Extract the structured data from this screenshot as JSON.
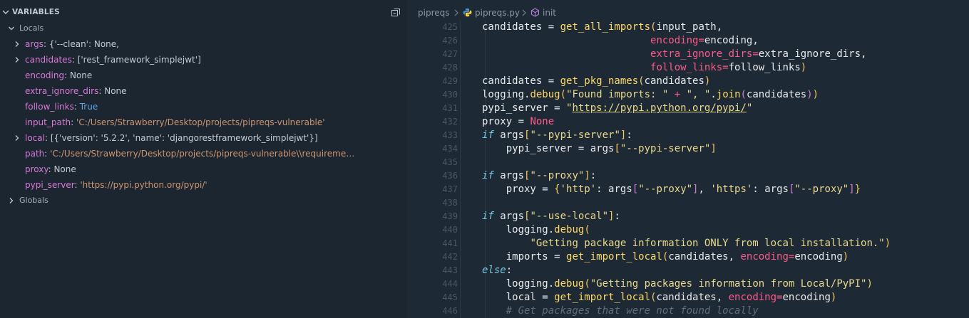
{
  "variables_panel": {
    "title": "VARIABLES",
    "locals_label": "Locals",
    "globals_label": "Globals",
    "locals": [
      {
        "name": "args",
        "value": "{'--clean': None,",
        "kind": "plain",
        "expandable": true
      },
      {
        "name": "candidates",
        "value": "['rest_framework_simplejwt']",
        "kind": "plain",
        "expandable": true
      },
      {
        "name": "encoding",
        "value": "None",
        "kind": "plain",
        "expandable": false
      },
      {
        "name": "extra_ignore_dirs",
        "value": "None",
        "kind": "plain",
        "expandable": false
      },
      {
        "name": "follow_links",
        "value": "True",
        "kind": "bool",
        "expandable": false
      },
      {
        "name": "input_path",
        "value": "'C:/Users/Strawberry/Desktop/projects/pipreqs-vulnerable'",
        "kind": "string",
        "expandable": false
      },
      {
        "name": "local",
        "value": "[{'version': '5.2.2', 'name': 'djangorestframework_simplejwt'}]",
        "kind": "plain",
        "expandable": true
      },
      {
        "name": "path",
        "value": "'C:/Users/Strawberry/Desktop/projects/pipreqs-vulnerable\\\\requireme…",
        "kind": "string",
        "expandable": false
      },
      {
        "name": "proxy",
        "value": "None",
        "kind": "plain",
        "expandable": false
      },
      {
        "name": "pypi_server",
        "value": "'https://pypi.python.org/pypi/'",
        "kind": "string",
        "expandable": false
      }
    ]
  },
  "breadcrumbs": [
    "pipreqs",
    "pipreqs.py",
    "init"
  ],
  "editor": {
    "lines": [
      {
        "n": "425",
        "indent": 0,
        "tokens": [
          [
            "var",
            "candidates "
          ],
          [
            "punc",
            "= "
          ],
          [
            "fn",
            "get_all_imports"
          ],
          [
            "paren",
            "("
          ],
          [
            "var",
            "input_path,"
          ]
        ]
      },
      {
        "n": "426",
        "indent": 0,
        "tokens": [
          [
            "var",
            "                            "
          ],
          [
            "param",
            "encoding"
          ],
          [
            "op",
            "="
          ],
          [
            "var",
            "encoding,"
          ]
        ]
      },
      {
        "n": "427",
        "indent": 0,
        "tokens": [
          [
            "var",
            "                            "
          ],
          [
            "param",
            "extra_ignore_dirs"
          ],
          [
            "op",
            "="
          ],
          [
            "var",
            "extra_ignore_dirs,"
          ]
        ]
      },
      {
        "n": "428",
        "indent": 0,
        "tokens": [
          [
            "var",
            "                            "
          ],
          [
            "param",
            "follow_links"
          ],
          [
            "op",
            "="
          ],
          [
            "var",
            "follow_links"
          ],
          [
            "paren",
            ")"
          ]
        ]
      },
      {
        "n": "429",
        "indent": 0,
        "tokens": [
          [
            "var",
            "candidates "
          ],
          [
            "punc",
            "= "
          ],
          [
            "fn",
            "get_pkg_names"
          ],
          [
            "paren",
            "("
          ],
          [
            "var",
            "candidates"
          ],
          [
            "paren",
            ")"
          ]
        ]
      },
      {
        "n": "430",
        "indent": 0,
        "tokens": [
          [
            "var",
            "logging."
          ],
          [
            "fn",
            "debug"
          ],
          [
            "paren",
            "("
          ],
          [
            "str",
            "\"Found imports: \""
          ],
          [
            "op",
            " + "
          ],
          [
            "str",
            "\", \""
          ],
          [
            "var",
            "."
          ],
          [
            "fn",
            "join"
          ],
          [
            "bracket",
            "("
          ],
          [
            "var",
            "candidates"
          ],
          [
            "bracket",
            ")"
          ],
          [
            "paren",
            ")"
          ]
        ]
      },
      {
        "n": "431",
        "indent": 0,
        "tokens": [
          [
            "var",
            "pypi_server "
          ],
          [
            "punc",
            "= "
          ],
          [
            "str",
            "\""
          ],
          [
            "url",
            "https://pypi.python.org/pypi/"
          ],
          [
            "str",
            "\""
          ]
        ]
      },
      {
        "n": "432",
        "indent": 0,
        "tokens": [
          [
            "var",
            "proxy "
          ],
          [
            "punc",
            "= "
          ],
          [
            "none",
            "None"
          ]
        ]
      },
      {
        "n": "433",
        "indent": 0,
        "tokens": [
          [
            "kw",
            "if "
          ],
          [
            "var",
            "args"
          ],
          [
            "paren",
            "["
          ],
          [
            "str",
            "\"--pypi-server\""
          ],
          [
            "paren",
            "]"
          ],
          [
            "var",
            ":"
          ]
        ]
      },
      {
        "n": "434",
        "indent": 1,
        "tokens": [
          [
            "var",
            "    pypi_server "
          ],
          [
            "punc",
            "= "
          ],
          [
            "var",
            "args"
          ],
          [
            "paren",
            "["
          ],
          [
            "str",
            "\"--pypi-server\""
          ],
          [
            "paren",
            "]"
          ]
        ]
      },
      {
        "n": "435",
        "indent": 0,
        "tokens": []
      },
      {
        "n": "436",
        "indent": 0,
        "tokens": [
          [
            "kw",
            "if "
          ],
          [
            "var",
            "args"
          ],
          [
            "paren",
            "["
          ],
          [
            "str",
            "\"--proxy\""
          ],
          [
            "paren",
            "]"
          ],
          [
            "var",
            ":"
          ]
        ]
      },
      {
        "n": "437",
        "indent": 1,
        "tokens": [
          [
            "var",
            "    proxy "
          ],
          [
            "punc",
            "= "
          ],
          [
            "paren",
            "{"
          ],
          [
            "str",
            "'http'"
          ],
          [
            "var",
            ": args"
          ],
          [
            "bracket",
            "["
          ],
          [
            "str",
            "\"--proxy\""
          ],
          [
            "bracket",
            "]"
          ],
          [
            "var",
            ", "
          ],
          [
            "str",
            "'https'"
          ],
          [
            "var",
            ": args"
          ],
          [
            "bracket",
            "["
          ],
          [
            "str",
            "\"--proxy\""
          ],
          [
            "bracket",
            "]"
          ],
          [
            "paren",
            "}"
          ]
        ]
      },
      {
        "n": "438",
        "indent": 0,
        "tokens": []
      },
      {
        "n": "439",
        "indent": 0,
        "tokens": [
          [
            "kw",
            "if "
          ],
          [
            "var",
            "args"
          ],
          [
            "paren",
            "["
          ],
          [
            "str",
            "\"--use-local\""
          ],
          [
            "paren",
            "]"
          ],
          [
            "var",
            ":"
          ]
        ]
      },
      {
        "n": "440",
        "indent": 1,
        "tokens": [
          [
            "var",
            "    logging."
          ],
          [
            "fn",
            "debug"
          ],
          [
            "paren",
            "("
          ]
        ]
      },
      {
        "n": "441",
        "indent": 2,
        "tokens": [
          [
            "var",
            "        "
          ],
          [
            "str",
            "\"Getting package information ONLY from local installation.\""
          ],
          [
            "paren",
            ")"
          ]
        ]
      },
      {
        "n": "442",
        "indent": 1,
        "tokens": [
          [
            "var",
            "    imports "
          ],
          [
            "punc",
            "= "
          ],
          [
            "fn",
            "get_import_local"
          ],
          [
            "paren",
            "("
          ],
          [
            "var",
            "candidates, "
          ],
          [
            "param",
            "encoding"
          ],
          [
            "op",
            "="
          ],
          [
            "var",
            "encoding"
          ],
          [
            "paren",
            ")"
          ]
        ]
      },
      {
        "n": "443",
        "indent": 0,
        "tokens": [
          [
            "kw",
            "else"
          ],
          [
            "var",
            ":"
          ]
        ]
      },
      {
        "n": "444",
        "indent": 1,
        "tokens": [
          [
            "var",
            "    logging."
          ],
          [
            "fn",
            "debug"
          ],
          [
            "paren",
            "("
          ],
          [
            "str",
            "\"Getting packages information from Local/PyPI\""
          ],
          [
            "paren",
            ")"
          ]
        ]
      },
      {
        "n": "445",
        "indent": 1,
        "tokens": [
          [
            "var",
            "    local "
          ],
          [
            "punc",
            "= "
          ],
          [
            "fn",
            "get_import_local"
          ],
          [
            "paren",
            "("
          ],
          [
            "var",
            "candidates, "
          ],
          [
            "param",
            "encoding"
          ],
          [
            "op",
            "="
          ],
          [
            "var",
            "encoding"
          ],
          [
            "paren",
            ")"
          ]
        ]
      },
      {
        "n": "446",
        "indent": 1,
        "tokens": [
          [
            "var",
            "    "
          ],
          [
            "comment",
            "# Get packages that were not found locally"
          ]
        ]
      }
    ]
  },
  "colors": {
    "panel_bg": "#1b2630",
    "editor_bg": "#1d2a35",
    "var_name": "#d879d6",
    "string": "#ce9570",
    "keyword": "#79c9e6",
    "function": "#ffd866",
    "param": "#fd5a87"
  },
  "icons": {
    "panel_chevron": "chevron-down-icon",
    "collapse_all": "collapse-all-icon",
    "python_file": "python-icon",
    "symbol": "cube-icon"
  }
}
